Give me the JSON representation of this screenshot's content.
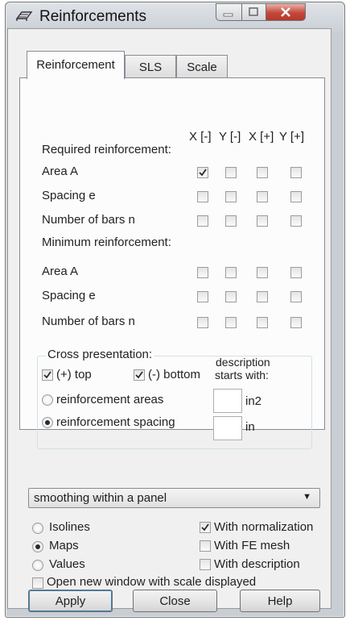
{
  "window": {
    "title": "Reinforcements"
  },
  "tabs": [
    {
      "label": "Reinforcement",
      "active": true
    },
    {
      "label": "SLS",
      "active": false
    },
    {
      "label": "Scale",
      "active": false
    }
  ],
  "columns": [
    "X [-]",
    "Y [-]",
    "X [+]",
    "Y [+]"
  ],
  "required": {
    "heading": "Required reinforcement:",
    "rows": [
      {
        "label": "Area A",
        "checks": [
          true,
          false,
          false,
          false
        ]
      },
      {
        "label": "Spacing e",
        "checks": [
          false,
          false,
          false,
          false
        ]
      },
      {
        "label": "Number of bars n",
        "checks": [
          false,
          false,
          false,
          false
        ]
      }
    ]
  },
  "minimum": {
    "heading": "Minimum reinforcement:",
    "rows": [
      {
        "label": "Area A",
        "checks": [
          false,
          false,
          false,
          false
        ]
      },
      {
        "label": "Spacing e",
        "checks": [
          false,
          false,
          false,
          false
        ]
      },
      {
        "label": "Number of bars n",
        "checks": [
          false,
          false,
          false,
          false
        ]
      }
    ]
  },
  "cross": {
    "legend": "Cross presentation:",
    "top_label": "(+) top",
    "top_checked": true,
    "bottom_label": "(-) bottom",
    "bottom_checked": true,
    "desc_line1": "description",
    "desc_line2": "starts with:",
    "areas_label": "reinforcement areas",
    "spacing_label": "reinforcement spacing",
    "selected": "spacing",
    "areas_value": "",
    "areas_unit": "in2",
    "spacing_value": "",
    "spacing_unit": "in"
  },
  "smoothing": {
    "value": "smoothing within a panel"
  },
  "display": {
    "isolines": "Isolines",
    "maps": "Maps",
    "values": "Values",
    "selected": "maps"
  },
  "options": {
    "normalization": "With normalization",
    "normalization_checked": true,
    "fe_mesh": "With FE mesh",
    "fe_mesh_checked": false,
    "description": "With description",
    "description_checked": false,
    "new_window": "Open new window with scale displayed",
    "new_window_checked": false
  },
  "buttons": {
    "apply": "Apply",
    "close": "Close",
    "help": "Help"
  }
}
